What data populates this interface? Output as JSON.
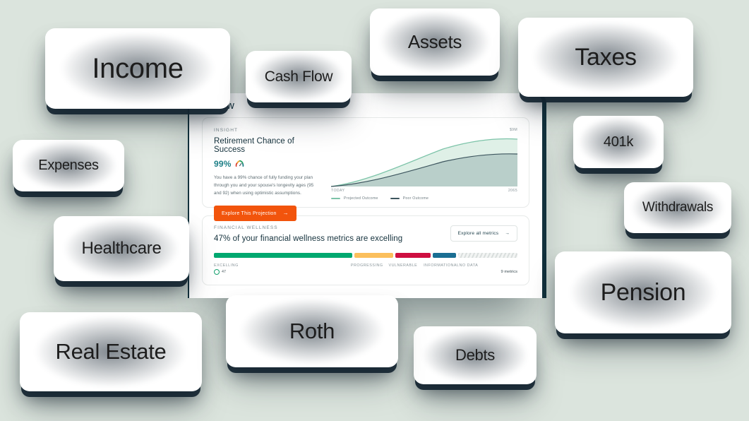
{
  "app": {
    "tab_label": "erview",
    "insight": {
      "eyebrow": "INSIGHT",
      "title": "Retirement Chance of Success",
      "score": "99%",
      "gauge_icon": "gauge-icon",
      "description": "You have a 99% chance of fully funding your plan through you and your spouse's longevity ages (95 and 92) when using optimistic assumptions.",
      "cta_label": "Explore This Projection",
      "cta_arrow": "→"
    },
    "wellness": {
      "eyebrow": "FINANCIAL WELLNESS",
      "title": "47% of your financial wellness metrics are excelling",
      "cta_label": "Explore all metrics",
      "cta_arrow": "→",
      "segments": [
        {
          "label": "EXCELLING",
          "percent": 47,
          "color": "#00a870"
        },
        {
          "label": "PROGRESSING",
          "percent": 13,
          "color": "#fbbf5c"
        },
        {
          "label": "VULNERABLE",
          "percent": 12,
          "color": "#ce0e40"
        },
        {
          "label": "INFORMATIONAL",
          "percent": 8,
          "color": "#1a6e93"
        },
        {
          "label": "NO DATA",
          "percent": 20,
          "color": "#e3e7e6"
        }
      ],
      "excelling_chip": "47",
      "metrics_count": "9 metrics"
    }
  },
  "chart_data": {
    "type": "area",
    "title": "Retirement Chance of Success",
    "xlabel": "",
    "ylabel": "",
    "x_tick_labels": [
      "TODAY",
      "2065"
    ],
    "y_tick_labels": [
      "$9M"
    ],
    "ylim": [
      0,
      9
    ],
    "grid": false,
    "legend_position": "bottom-left",
    "x": [
      0,
      10,
      20,
      30,
      40,
      50,
      60,
      70,
      80,
      90,
      100
    ],
    "series": [
      {
        "name": "Projected Outcome",
        "color": "#7cc3a8",
        "fill": "#dff0e7",
        "values": [
          0.05,
          0.85,
          1.85,
          2.95,
          4.1,
          5.25,
          6.3,
          7.15,
          7.7,
          7.9,
          7.8
        ]
      },
      {
        "name": "Poor Outcome",
        "color": "#3d555e",
        "fill": "#b9cfca",
        "values": [
          0.05,
          0.55,
          1.2,
          1.95,
          2.8,
          3.65,
          4.45,
          5.1,
          5.5,
          5.65,
          5.6
        ]
      }
    ]
  },
  "topics": [
    {
      "id": "card-income",
      "label": "Income"
    },
    {
      "id": "card-cashflow",
      "label": "Cash Flow"
    },
    {
      "id": "card-assets",
      "label": "Assets"
    },
    {
      "id": "card-taxes",
      "label": "Taxes"
    },
    {
      "id": "card-401k",
      "label": "401k"
    },
    {
      "id": "card-withdraw",
      "label": "Withdrawals"
    },
    {
      "id": "card-pension",
      "label": "Pension"
    },
    {
      "id": "card-expenses",
      "label": "Expenses"
    },
    {
      "id": "card-health",
      "label": "Healthcare"
    },
    {
      "id": "card-realest",
      "label": "Real Estate"
    },
    {
      "id": "card-roth",
      "label": "Roth"
    },
    {
      "id": "card-debts",
      "label": "Debts"
    }
  ],
  "theme": {
    "background": "#dbe4dd",
    "panel_edge": "#12313c",
    "accent_orange": "#f2540c",
    "accent_teal": "#1d7f87",
    "card_shadow": "#142430"
  }
}
